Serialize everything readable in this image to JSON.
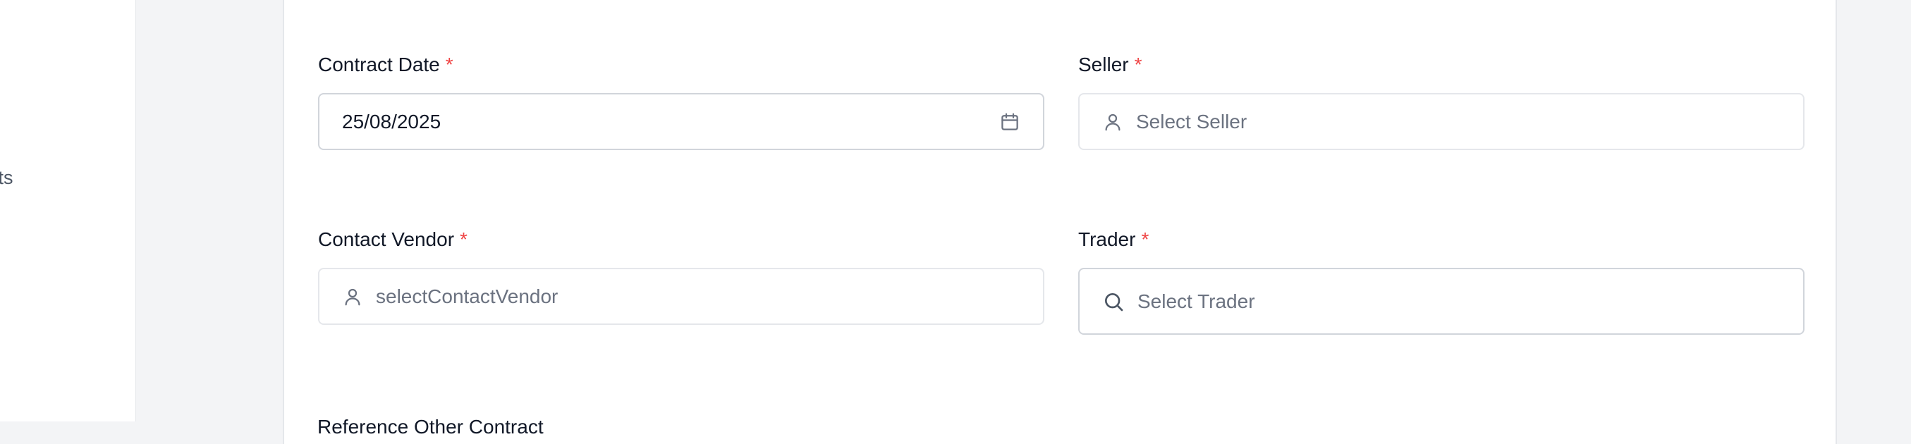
{
  "sidebar": {
    "items": [
      {
        "label": "racts"
      }
    ]
  },
  "form": {
    "contract_date": {
      "label": "Contract Date",
      "required": "*",
      "value": "25/08/2025",
      "icon": "calendar-icon"
    },
    "seller": {
      "label": "Seller",
      "required": "*",
      "placeholder": "Select Seller",
      "icon": "user-icon"
    },
    "contact_vendor": {
      "label": "Contact Vendor",
      "required": "*",
      "placeholder": "selectContactVendor",
      "icon": "user-icon"
    },
    "trader": {
      "label": "Trader",
      "required": "*",
      "placeholder": "Select Trader",
      "icon": "search-icon"
    },
    "partial_next_label": "Reference Other Contract"
  },
  "colors": {
    "page_background": "#f3f4f6",
    "card_background": "#ffffff",
    "required": "#ef4444",
    "border": "#d1d5db",
    "placeholder": "#6b7280"
  }
}
